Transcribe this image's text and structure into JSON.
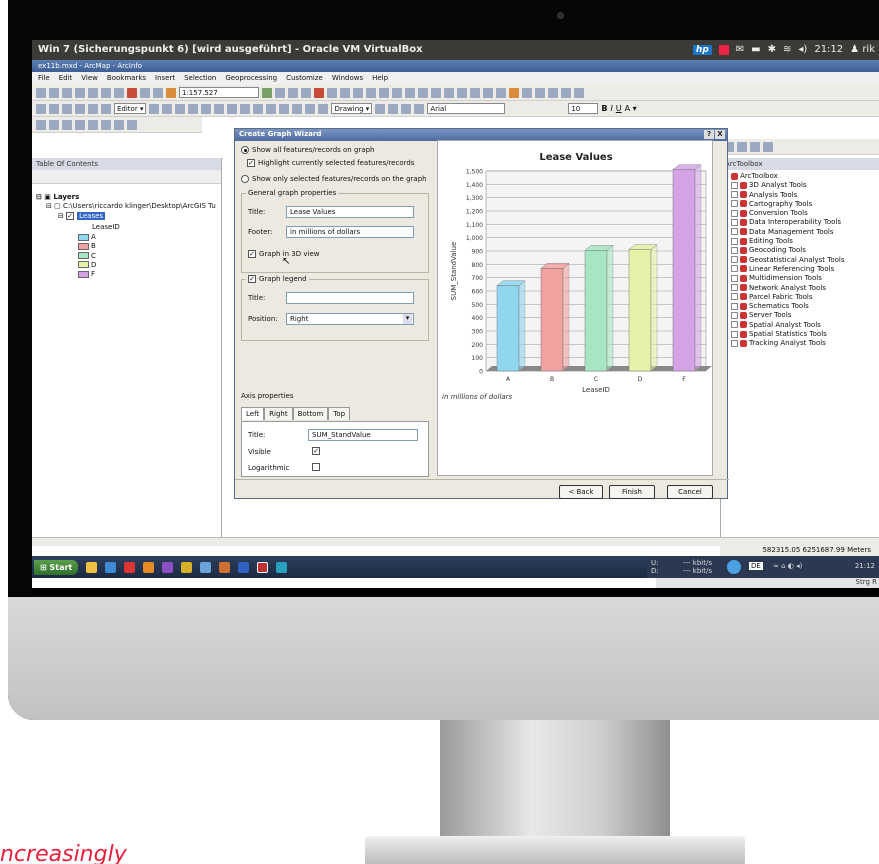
{
  "os_bar": {
    "title": "Win 7 (Sicherungspunkt 6) [wird ausgeführt] - Oracle VM VirtualBox",
    "brand": "hp",
    "time": "21:12",
    "user": "rik"
  },
  "app": {
    "title": "ex11b.mxd - ArcMap - ArcInfo",
    "menu": [
      "File",
      "Edit",
      "View",
      "Bookmarks",
      "Insert",
      "Selection",
      "Geoprocessing",
      "Customize",
      "Windows",
      "Help"
    ],
    "scale": "1:157.527",
    "editor_label": "Editor ▾",
    "drawing_label": "Drawing ▾",
    "font_name": "Arial",
    "font_size": "10"
  },
  "toc": {
    "title": "Table Of Contents",
    "root": "Layers",
    "path": "C:\\Users\\riccardo klinger\\Desktop\\ArcGIS Tu",
    "layer": "Leases",
    "field": "LeaseID",
    "legend": [
      {
        "label": "A",
        "color": "#8fd6ef"
      },
      {
        "label": "B",
        "color": "#f2a1a1"
      },
      {
        "label": "C",
        "color": "#a8e6c3"
      },
      {
        "label": "D",
        "color": "#e6f0a6"
      },
      {
        "label": "F",
        "color": "#d3a3e6"
      }
    ]
  },
  "toolbox": {
    "title": "ArcToolbox",
    "root": "ArcToolbox",
    "tools": [
      "3D Analyst Tools",
      "Analysis Tools",
      "Cartography Tools",
      "Conversion Tools",
      "Data Interoperability Tools",
      "Data Management Tools",
      "Editing Tools",
      "Geocoding Tools",
      "Geostatistical Analyst Tools",
      "Linear Referencing Tools",
      "Multidimension Tools",
      "Network Analyst Tools",
      "Parcel Fabric Tools",
      "Schematics Tools",
      "Server Tools",
      "Spatial Analyst Tools",
      "Spatial Statistics Tools",
      "Tracking Analyst Tools"
    ]
  },
  "dialog": {
    "title": "Create Graph Wizard",
    "help": "?",
    "close": "X",
    "opt_all": "Show all features/records on graph",
    "opt_highlight": "Highlight currently selected features/records",
    "opt_selected": "Show only selected features/records on the graph",
    "general": {
      "legend": "General graph properties",
      "title_label": "Title:",
      "title_value": "Lease Values",
      "footer_label": "Footer:",
      "footer_value": "in millions of dollars",
      "view3d": "Graph in 3D view"
    },
    "legend_group": {
      "legend": "Graph legend",
      "title_label": "Title:",
      "title_value": "",
      "position_label": "Position:",
      "position_value": "Right"
    },
    "axis": {
      "heading": "Axis properties",
      "tabs": [
        "Left",
        "Right",
        "Bottom",
        "Top"
      ],
      "title_label": "Title:",
      "title_value": "SUM_StandValue",
      "visible_label": "Visible",
      "log_label": "Logarithmic"
    },
    "buttons": {
      "back": "< Back",
      "finish": "Finish",
      "cancel": "Cancel"
    }
  },
  "chart_data": {
    "type": "bar",
    "title": "Lease Values",
    "footer": "in millions of dollars",
    "xlabel": "LeaseID",
    "ylabel": "SUM_StandValue",
    "categories": [
      "A",
      "B",
      "C",
      "D",
      "F"
    ],
    "values": [
      640,
      770,
      905,
      910,
      1510
    ],
    "colors": [
      "#8fd6ef",
      "#f2a1a1",
      "#a8e6c3",
      "#e6f0a6",
      "#d3a3e6"
    ],
    "ylim": [
      0,
      1500
    ],
    "yticks": [
      0,
      100,
      200,
      300,
      400,
      500,
      600,
      700,
      800,
      900,
      1000,
      1100,
      1200,
      1300,
      1400,
      1500
    ],
    "ytick_labels": [
      "0",
      "100",
      "200",
      "300",
      "400",
      "500",
      "600",
      "700",
      "800",
      "900",
      "1,000",
      "1,100",
      "1,200",
      "1,300",
      "1,400",
      "1,500"
    ],
    "grid": true,
    "style": "3d"
  },
  "status": {
    "coords": "582315.05 6251687.99 Meters"
  },
  "taskbar": {
    "start": "Start",
    "kbit1": "--- kbit/s",
    "kbit2": "--- kbit/s",
    "drive_u": "U:",
    "drive_d": "D:",
    "lang": "DE",
    "time": "21:12",
    "strg": "Strg R"
  }
}
